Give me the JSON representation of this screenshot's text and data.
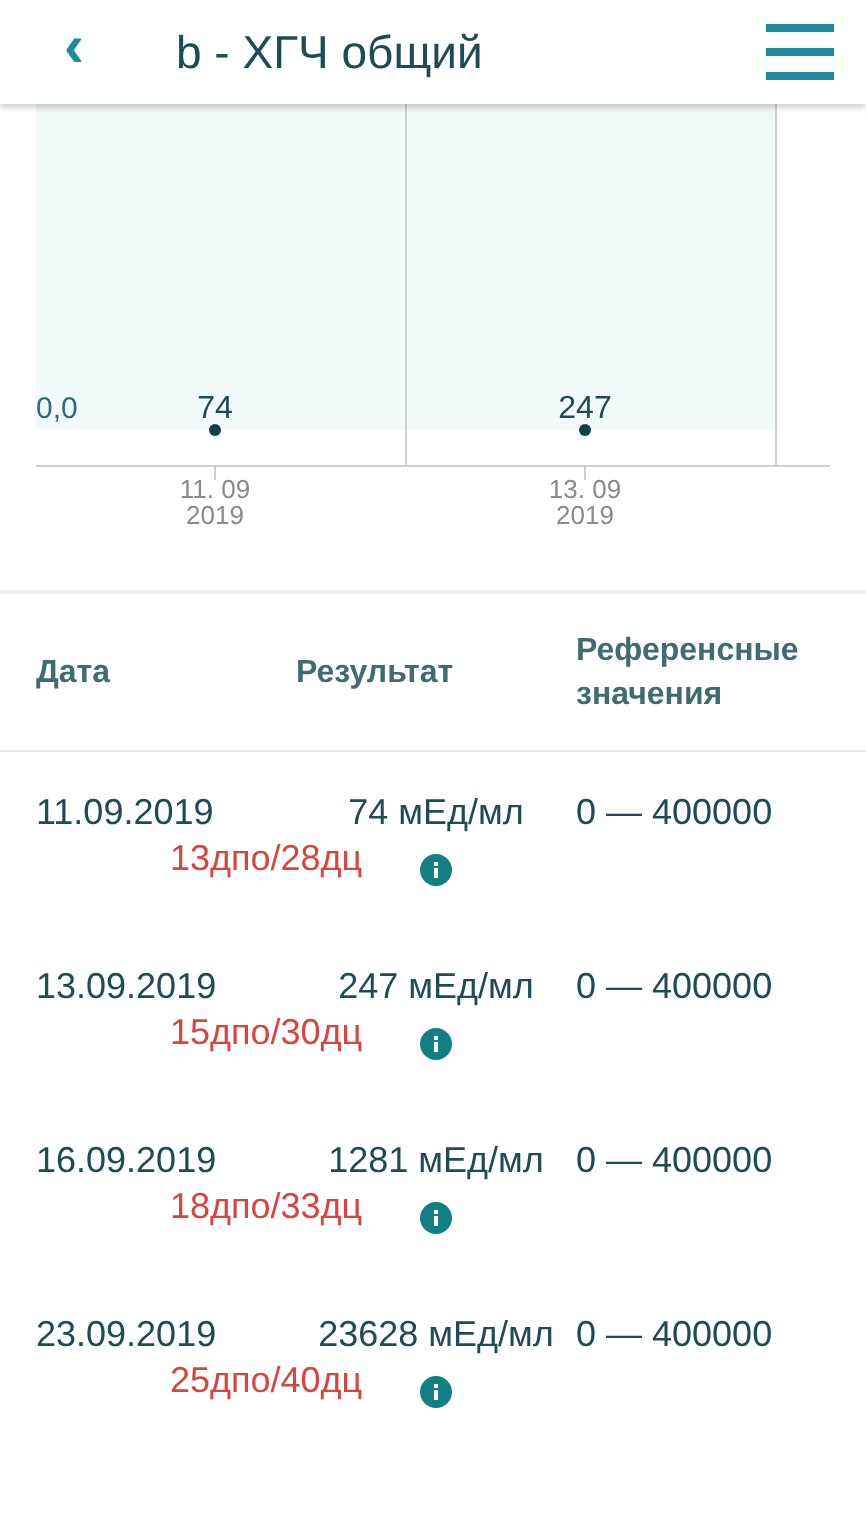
{
  "header": {
    "back": "‹",
    "title": "b - ХГЧ общий"
  },
  "chart": {
    "axis_label": "0,0",
    "points": [
      {
        "value": "74",
        "date": "11. 09 2019"
      },
      {
        "value": "247",
        "date": "13. 09 2019"
      }
    ]
  },
  "table": {
    "columns": [
      "Дата",
      "Результат",
      "Референсные значения"
    ],
    "rows": [
      {
        "date": "11.09.2019",
        "note": "13дпо/28дц",
        "result": "74 мЕд/мл",
        "reference": "0 — 400000"
      },
      {
        "date": "13.09.2019",
        "note": "15дпо/30дц",
        "result": "247 мЕд/мл",
        "reference": "0 — 400000"
      },
      {
        "date": "16.09.2019",
        "note": "18дпо/33дц",
        "result": "1281 мЕд/мл",
        "reference": "0 — 400000"
      },
      {
        "date": "23.09.2019",
        "note": "25дпо/40дц",
        "result": "23628 мЕд/мл",
        "reference": "0 — 400000"
      }
    ]
  }
}
